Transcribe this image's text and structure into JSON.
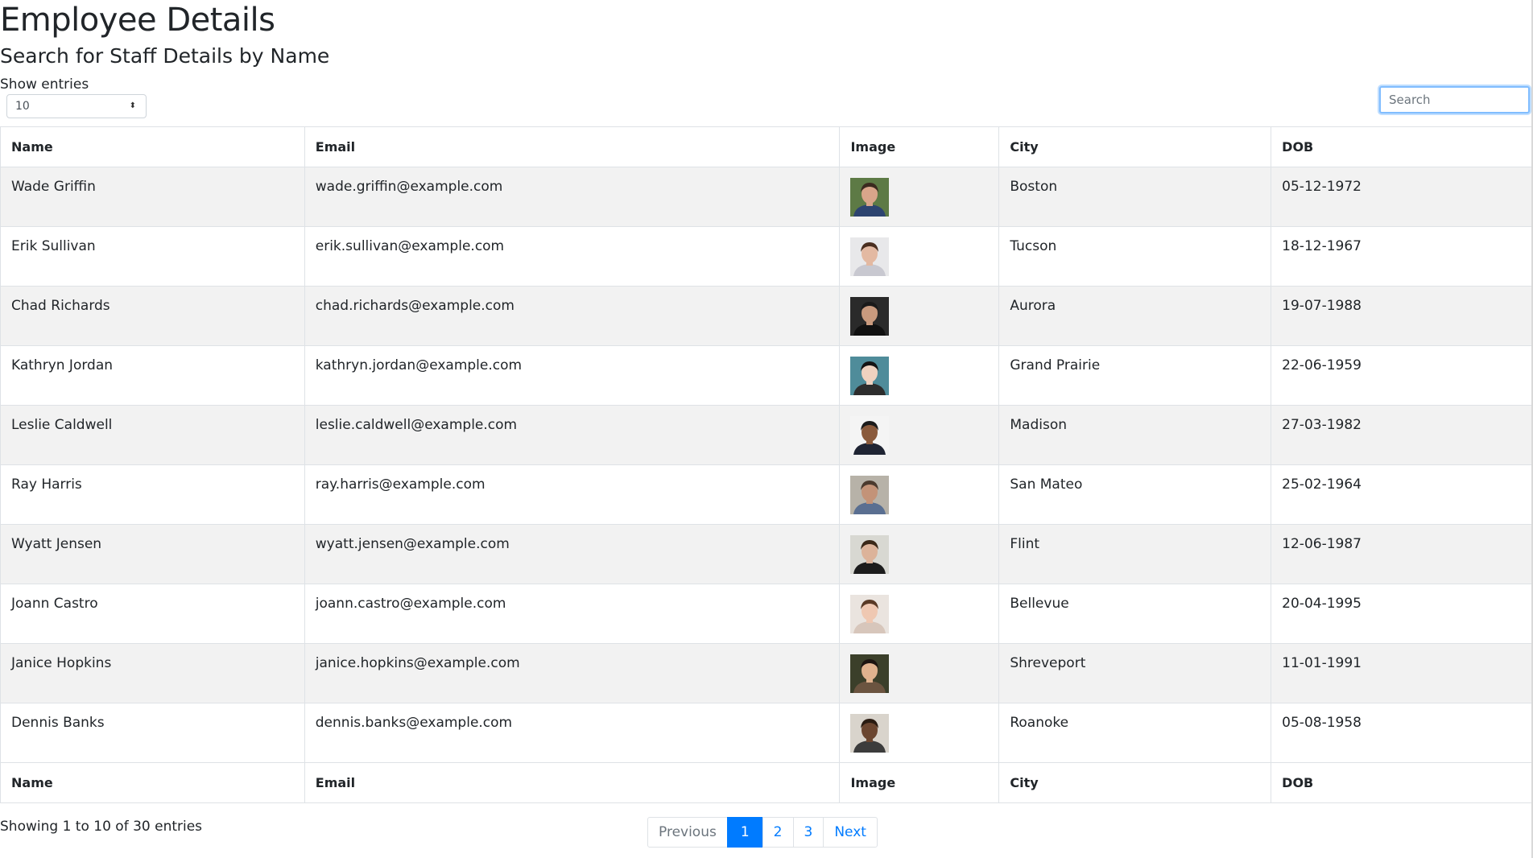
{
  "page": {
    "title": "Employee Details",
    "subtitle": "Search for Staff Details by Name"
  },
  "length": {
    "label": "Show entries",
    "value": "10",
    "caret": "⬍"
  },
  "search": {
    "placeholder": "Search",
    "value": ""
  },
  "table": {
    "columns": [
      "Name",
      "Email",
      "Image",
      "City",
      "DOB"
    ],
    "rows": [
      {
        "name": "Wade Griffin",
        "email": "wade.griffin@example.com",
        "city": "Boston",
        "dob": "05-12-1972",
        "avatar": {
          "bg": "#5d7a45",
          "skin": "#d9a58a",
          "hair": "#3b2a1f",
          "shirt": "#2d4470"
        }
      },
      {
        "name": "Erik Sullivan",
        "email": "erik.sullivan@example.com",
        "city": "Tucson",
        "dob": "18-12-1967",
        "avatar": {
          "bg": "#e8e8ea",
          "skin": "#e3b9a2",
          "hair": "#4a2f20",
          "shirt": "#c8c8d0"
        }
      },
      {
        "name": "Chad Richards",
        "email": "chad.richards@example.com",
        "city": "Aurora",
        "dob": "19-07-1988",
        "avatar": {
          "bg": "#2a2a2a",
          "skin": "#c99a7e",
          "hair": "#1a1a1a",
          "shirt": "#111111"
        }
      },
      {
        "name": "Kathryn Jordan",
        "email": "kathryn.jordan@example.com",
        "city": "Grand Prairie",
        "dob": "22-06-1959",
        "avatar": {
          "bg": "#4f8c9a",
          "skin": "#efd2c0",
          "hair": "#141414",
          "shirt": "#2d2d2d"
        }
      },
      {
        "name": "Leslie Caldwell",
        "email": "leslie.caldwell@example.com",
        "city": "Madison",
        "dob": "27-03-1982",
        "avatar": {
          "bg": "#f4f4f4",
          "skin": "#8a5a3c",
          "hair": "#1b1b1b",
          "shirt": "#1f2433"
        }
      },
      {
        "name": "Ray Harris",
        "email": "ray.harris@example.com",
        "city": "San Mateo",
        "dob": "25-02-1964",
        "avatar": {
          "bg": "#b7b2a8",
          "skin": "#c39378",
          "hair": "#4b3a2e",
          "shirt": "#5a6f91"
        }
      },
      {
        "name": "Wyatt Jensen",
        "email": "wyatt.jensen@example.com",
        "city": "Flint",
        "dob": "12-06-1987",
        "avatar": {
          "bg": "#d8d8d2",
          "skin": "#dcb39a",
          "hair": "#3a2818",
          "shirt": "#1c1c1c"
        }
      },
      {
        "name": "Joann Castro",
        "email": "joann.castro@example.com",
        "city": "Bellevue",
        "dob": "20-04-1995",
        "avatar": {
          "bg": "#eae4df",
          "skin": "#efc8b2",
          "hair": "#5a3a26",
          "shirt": "#d7c6bb"
        }
      },
      {
        "name": "Janice Hopkins",
        "email": "janice.hopkins@example.com",
        "city": "Shreveport",
        "dob": "11-01-1991",
        "avatar": {
          "bg": "#3b3f2a",
          "skin": "#e0b28e",
          "hair": "#1c1410",
          "shirt": "#6b5440"
        }
      },
      {
        "name": "Dennis Banks",
        "email": "dennis.banks@example.com",
        "city": "Roanoke",
        "dob": "05-08-1958",
        "avatar": {
          "bg": "#d9d4cc",
          "skin": "#6b4630",
          "hair": "#2a1c12",
          "shirt": "#3c3c3c"
        }
      }
    ]
  },
  "footer": {
    "info": "Showing 1 to 10 of 30 entries",
    "pagination": {
      "previous": "Previous",
      "pages": [
        "1",
        "2",
        "3"
      ],
      "next": "Next"
    }
  }
}
